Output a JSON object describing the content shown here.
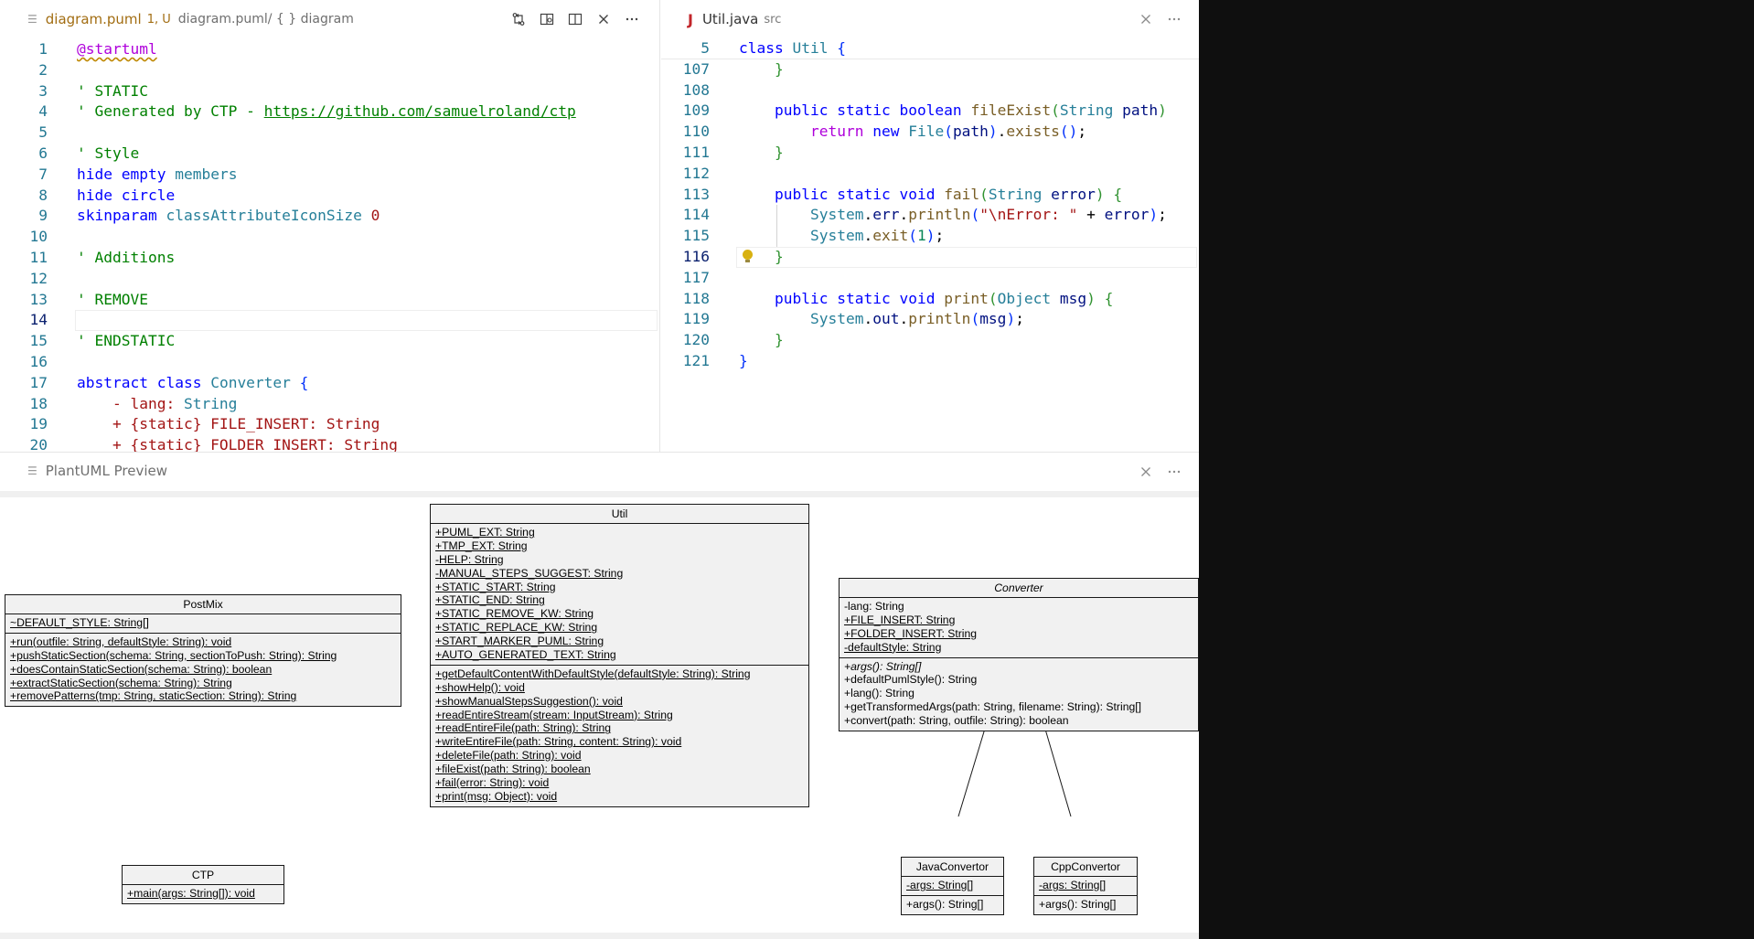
{
  "left_editor": {
    "tab_title": "diagram.puml",
    "tab_badge": "1, U",
    "breadcrumb": "diagram.puml/ { } diagram",
    "lines": [
      {
        "n": "1",
        "html": "<span class=\"squig\">@startuml</span>"
      },
      {
        "n": "2",
        "html": ""
      },
      {
        "n": "3",
        "html": "<span class=\"cm\">' STATIC</span>"
      },
      {
        "n": "4",
        "html": "<span class=\"cm\">' Generated by CTP - </span><span class=\"lnk\">https://github.com/samuelroland/ctp</span>"
      },
      {
        "n": "5",
        "html": ""
      },
      {
        "n": "6",
        "html": "<span class=\"cm\">' Style</span>"
      },
      {
        "n": "7",
        "html": "<span class=\"kw\">hide</span> <span class=\"kw\">empty</span> <span class=\"cls\">members</span>"
      },
      {
        "n": "8",
        "html": "<span class=\"kw\">hide</span> <span class=\"kw\">circle</span>"
      },
      {
        "n": "9",
        "html": "<span class=\"kw\">skinparam</span> <span class=\"cls\">classAttributeIconSize</span> <span class=\"st\">0</span>"
      },
      {
        "n": "10",
        "html": ""
      },
      {
        "n": "11",
        "html": "<span class=\"cm\">' Additions</span>"
      },
      {
        "n": "12",
        "html": ""
      },
      {
        "n": "13",
        "html": "<span class=\"cm\">' REMOVE</span>"
      },
      {
        "n": "14",
        "html": "",
        "current": true
      },
      {
        "n": "15",
        "html": "<span class=\"cm\">' ENDSTATIC</span>"
      },
      {
        "n": "16",
        "html": ""
      },
      {
        "n": "17",
        "html": "<span class=\"kw\">abstract</span> <span class=\"kw\">class</span> <span class=\"cls\">Converter</span> <span class=\"br1\">{</span>"
      },
      {
        "n": "18",
        "html": "    <span class=\"st\">- lang: </span><span class=\"cls\">String</span>"
      },
      {
        "n": "19",
        "html": "    <span class=\"st\">+ {static} FILE_INSERT: String</span>"
      },
      {
        "n": "20",
        "html": "    <span class=\"st\">+ {static} FOLDER_INSERT: String</span>"
      }
    ]
  },
  "right_editor": {
    "tab_icon": "J",
    "tab_title": "Util.java",
    "tab_desc": "src",
    "sticky": {
      "n": "5",
      "html": "<span class=\"k\">class</span> <span class=\"ty\">Util</span> <span class=\"br1\">{</span>"
    },
    "lines": [
      {
        "n": "107",
        "html": "    <span class=\"br2\">}</span>"
      },
      {
        "n": "108",
        "html": ""
      },
      {
        "n": "109",
        "html": "    <span class=\"k\">public</span> <span class=\"k\">static</span> <span class=\"k\">boolean</span> <span class=\"fn\">fileExist</span><span class=\"br2\">(</span><span class=\"ty\">String</span> <span class=\"vr\">path</span><span class=\"br2\">)</span>"
      },
      {
        "n": "110",
        "html": "        <span class=\"purple\">return</span> <span class=\"k\">new</span> <span class=\"ty\">File</span><span class=\"br1\">(</span><span class=\"vr\">path</span><span class=\"br1\">)</span>.<span class=\"fn\">exists</span><span class=\"br1\">()</span>;"
      },
      {
        "n": "111",
        "html": "    <span class=\"br2\">}</span>"
      },
      {
        "n": "112",
        "html": ""
      },
      {
        "n": "113",
        "html": "    <span class=\"k\">public</span> <span class=\"k\">static</span> <span class=\"k\">void</span> <span class=\"fn\">fail</span><span class=\"br2\">(</span><span class=\"ty\">String</span> <span class=\"vr\">error</span><span class=\"br2\">)</span> <span class=\"br2\">{</span>"
      },
      {
        "n": "114",
        "html": "        <span class=\"ty\">System</span>.<span class=\"vr\">err</span>.<span class=\"fn\">println</span><span class=\"br1\">(</span><span class=\"st\">\"\\nError: \"</span> + <span class=\"vr\">error</span><span class=\"br1\">)</span>;"
      },
      {
        "n": "115",
        "html": "        <span class=\"ty\">System</span>.<span class=\"fn\">exit</span><span class=\"br1\">(</span><span class=\"nm\">1</span><span class=\"br1\">)</span>;"
      },
      {
        "n": "116",
        "html": "    <span class=\"br2\">}</span>",
        "current": true,
        "bulb": true
      },
      {
        "n": "117",
        "html": ""
      },
      {
        "n": "118",
        "html": "    <span class=\"k\">public</span> <span class=\"k\">static</span> <span class=\"k\">void</span> <span class=\"fn\">print</span><span class=\"br2\">(</span><span class=\"ty\">Object</span> <span class=\"vr\">msg</span><span class=\"br2\">)</span> <span class=\"br2\">{</span>"
      },
      {
        "n": "119",
        "html": "        <span class=\"ty\">System</span>.<span class=\"vr\">out</span>.<span class=\"fn\">println</span><span class=\"br1\">(</span><span class=\"vr\">msg</span><span class=\"br1\">)</span>;"
      },
      {
        "n": "120",
        "html": "    <span class=\"br2\">}</span>"
      },
      {
        "n": "121",
        "html": "<span class=\"br1\">}</span>"
      }
    ]
  },
  "preview": {
    "title": "PlantUML Preview",
    "classes": [
      {
        "id": "util",
        "name": "Util",
        "italic": false,
        "fields": [
          {
            "t": "+PUML_EXT: String",
            "s": "u"
          },
          {
            "t": "+TMP_EXT: String",
            "s": "u"
          },
          {
            "t": "-HELP: String",
            "s": "u"
          },
          {
            "t": "-MANUAL_STEPS_SUGGEST: String",
            "s": "u"
          },
          {
            "t": "+STATIC_START: String",
            "s": "u"
          },
          {
            "t": "+STATIC_END: String",
            "s": "u"
          },
          {
            "t": "+STATIC_REMOVE_KW: String",
            "s": "u"
          },
          {
            "t": "+STATIC_REPLACE_KW: String",
            "s": "u"
          },
          {
            "t": "+START_MARKER_PUML: String",
            "s": "u"
          },
          {
            "t": "+AUTO_GENERATED_TEXT: String",
            "s": "u"
          }
        ],
        "methods": [
          {
            "t": "+getDefaultContentWithDefaultStyle(defaultStyle: String): String",
            "s": "u"
          },
          {
            "t": "+showHelp(): void",
            "s": "u"
          },
          {
            "t": "+showManualStepsSuggestion(): void",
            "s": "u"
          },
          {
            "t": "+readEntireStream(stream: InputStream): String",
            "s": "u"
          },
          {
            "t": "+readEntireFile(path: String): String",
            "s": "u"
          },
          {
            "t": "+writeEntireFile(path: String, content: String): void",
            "s": "u"
          },
          {
            "t": "+deleteFile(path: String): void",
            "s": "u"
          },
          {
            "t": "+fileExist(path: String): boolean",
            "s": "u"
          },
          {
            "t": "+fail(error: String): void",
            "s": "u"
          },
          {
            "t": "+print(msg: Object): void",
            "s": "u"
          }
        ]
      },
      {
        "id": "postmix",
        "name": "PostMix",
        "italic": false,
        "fields": [
          {
            "t": "~DEFAULT_STYLE: String[]",
            "s": "u"
          }
        ],
        "methods": [
          {
            "t": "+run(outfile: String, defaultStyle: String): void",
            "s": "u"
          },
          {
            "t": "+pushStaticSection(schema: String, sectionToPush: String): String",
            "s": "u"
          },
          {
            "t": "+doesContainStaticSection(schema: String): boolean",
            "s": "u"
          },
          {
            "t": "+extractStaticSection(schema: String): String",
            "s": "u"
          },
          {
            "t": "+removePatterns(tmp: String, staticSection: String): String",
            "s": "u"
          }
        ]
      },
      {
        "id": "converter",
        "name": "Converter",
        "italic": true,
        "fields": [
          {
            "t": "-lang: String",
            "s": ""
          },
          {
            "t": "+FILE_INSERT: String",
            "s": "u"
          },
          {
            "t": "+FOLDER_INSERT: String",
            "s": "u"
          },
          {
            "t": "-defaultStyle: String",
            "s": "u"
          }
        ],
        "methods": [
          {
            "t": "+args(): String[]",
            "s": "i"
          },
          {
            "t": "+defaultPumlStyle(): String",
            "s": ""
          },
          {
            "t": "+lang(): String",
            "s": ""
          },
          {
            "t": "+getTransformedArgs(path: String, filename: String): String[]",
            "s": ""
          },
          {
            "t": "+convert(path: String, outfile: String): boolean",
            "s": ""
          }
        ]
      },
      {
        "id": "ctp",
        "name": "CTP",
        "italic": false,
        "fields": [],
        "methods": [
          {
            "t": "+main(args: String[]): void",
            "s": "u"
          }
        ]
      },
      {
        "id": "javaconvertor",
        "name": "JavaConvertor",
        "italic": false,
        "fields": [
          {
            "t": "-args: String[]",
            "s": "u"
          }
        ],
        "methods": [
          {
            "t": "+args(): String[]",
            "s": ""
          }
        ]
      },
      {
        "id": "cppconvertor",
        "name": "CppConvertor",
        "italic": false,
        "fields": [
          {
            "t": "-args: String[]",
            "s": "u"
          }
        ],
        "methods": [
          {
            "t": "+args(): String[]",
            "s": ""
          }
        ]
      }
    ]
  },
  "icons": [
    "file-lines-icon",
    "compare-changes-icon",
    "open-preview-icon",
    "split-editor-icon",
    "close-icon",
    "more-actions-icon",
    "lightbulb-icon"
  ]
}
